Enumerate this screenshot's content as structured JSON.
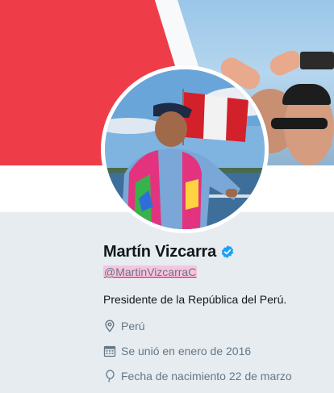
{
  "profile": {
    "name": "Martín Vizcarra",
    "handle": "@MartinVizcarraC",
    "bio": "Presidente de la República del Perú.",
    "location": "Perú",
    "joined": "Se unió en enero de 2016",
    "birthday": "Fecha de nacimiento 22 de marzo",
    "verified": true
  },
  "icons": {
    "verified": "verified-badge-icon",
    "location": "location-pin-icon",
    "joined": "calendar-icon",
    "birthday": "balloon-icon"
  },
  "colors": {
    "accent": "#1da1f2",
    "banner_red": "#ee3d49",
    "page_bg": "#e6ecf0",
    "secondary_text": "#657786"
  }
}
